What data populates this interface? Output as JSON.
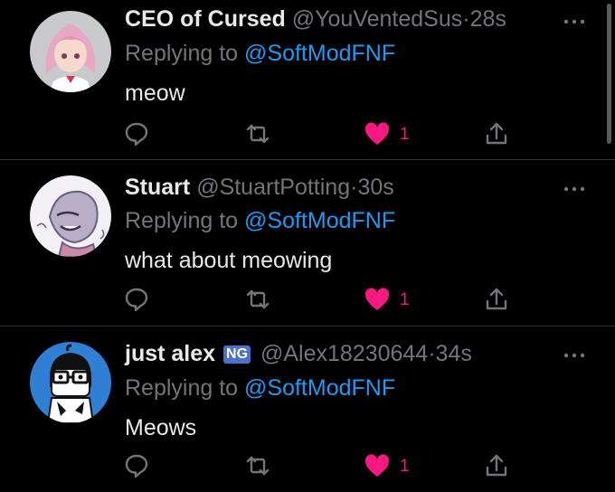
{
  "tweets": [
    {
      "name": "CEO of Cursed",
      "handle": "@YouVentedSus",
      "separator": "·",
      "time": "28s",
      "replying_prefix": "Replying to ",
      "replying_to": "@SoftModFNF",
      "text": "meow",
      "likes": "1",
      "badge": ""
    },
    {
      "name": "Stuart",
      "handle": "@StuartPotting",
      "separator": "·",
      "time": "30s",
      "replying_prefix": "Replying to ",
      "replying_to": "@SoftModFNF",
      "text": "what about meowing",
      "likes": "1",
      "badge": ""
    },
    {
      "name": "just alex",
      "handle": "@Alex18230644",
      "separator": "·",
      "time": "34s",
      "replying_prefix": "Replying to ",
      "replying_to": "@SoftModFNF",
      "text": "Meows",
      "likes": "1",
      "badge": "NG"
    }
  ],
  "colors": {
    "background": "#000000",
    "text": "#e7e9ea",
    "muted": "#71767b",
    "link": "#1d9bf0",
    "like": "#f91880"
  }
}
